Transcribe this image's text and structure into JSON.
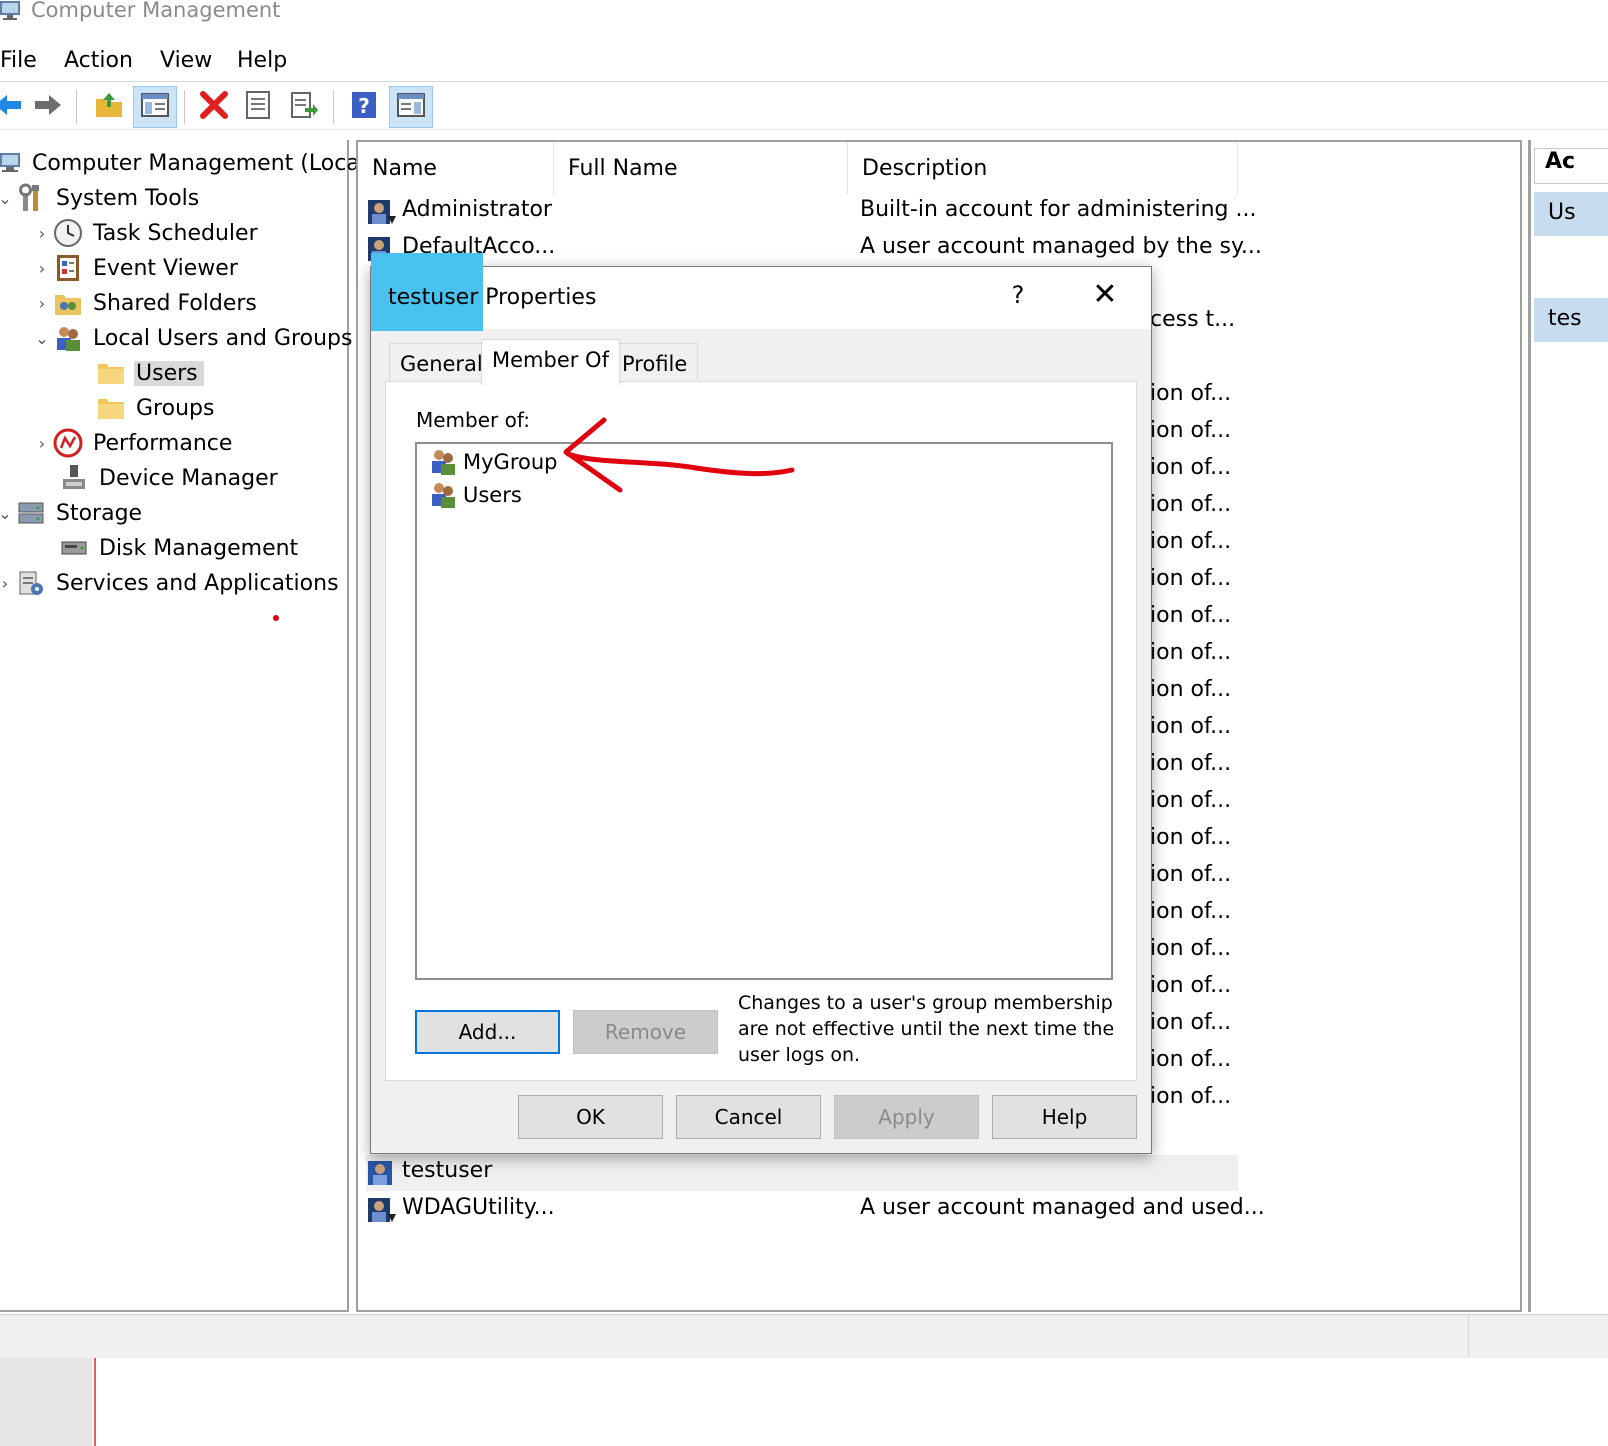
{
  "window": {
    "title": "Computer Management"
  },
  "menu": [
    "File",
    "Action",
    "View",
    "Help"
  ],
  "toolbar": {
    "buttons": [
      "back-icon",
      "forward-icon",
      "up-folder-icon",
      "show-hide-tree-icon",
      "delete-icon",
      "properties-icon",
      "export-list-icon",
      "help-icon",
      "show-hide-action-pane-icon"
    ]
  },
  "tree": {
    "root": "Computer Management (Local)",
    "system_tools": "System Tools",
    "task_scheduler": "Task Scheduler",
    "event_viewer": "Event Viewer",
    "shared_folders": "Shared Folders",
    "local_users_groups": "Local Users and Groups",
    "users": "Users",
    "groups": "Groups",
    "performance": "Performance",
    "device_manager": "Device Manager",
    "storage": "Storage",
    "disk_management": "Disk Management",
    "services_apps": "Services and Applications"
  },
  "list": {
    "headers": {
      "name": "Name",
      "full_name": "Full Name",
      "description": "Description"
    },
    "rows": [
      {
        "name": "Administrator",
        "description": "Built-in account for administering ..."
      },
      {
        "name": "DefaultAcco...",
        "description": "A user account managed by the sy..."
      },
      {
        "name": "testuser",
        "description": ""
      },
      {
        "name": "WDAGUtility...",
        "description": "A user account managed and used..."
      }
    ],
    "fragments": [
      "cess t...",
      "ion of...",
      "ion of...",
      "ion of...",
      "ion of...",
      "ion of...",
      "ion of...",
      "ion of...",
      "ion of...",
      "ion of...",
      "ion of...",
      "ion of...",
      "ion of...",
      "ion of...",
      "ion of...",
      "ion of...",
      "ion of...",
      "ion of...",
      "ion of...",
      "ion of...",
      "ion of..."
    ]
  },
  "actions": {
    "header": "Ac",
    "item1": "Us",
    "item2": "tes"
  },
  "dialog": {
    "title": "testuser Properties",
    "help": "?",
    "close": "✕",
    "tabs": [
      "General",
      "Member Of",
      "Profile"
    ],
    "member_of_label": "Member of:",
    "members": [
      "MyGroup",
      "Users"
    ],
    "add": "Add...",
    "remove": "Remove",
    "note": "Changes to a user's group membership are not effective until the next time the user logs on.",
    "ok": "OK",
    "cancel": "Cancel",
    "apply": "Apply",
    "help_button": "Help"
  },
  "colors": {
    "highlight": "#49c2ef",
    "annotation": "#e0000e",
    "accent": "#0078d7"
  }
}
